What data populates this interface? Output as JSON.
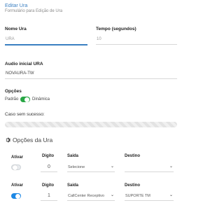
{
  "header": {
    "title": "Editar Ura",
    "subtitle": "Formulário para Edição de Ura"
  },
  "form": {
    "nome_ura": {
      "label": "Nome Ura",
      "value": "URA"
    },
    "tempo": {
      "label": "Tempo (segundos)",
      "value": "10"
    },
    "audio": {
      "label": "Audio inicial URA",
      "value": "NOVAURA-TW"
    },
    "opcoes": {
      "label": "Opções",
      "left": "Padrão",
      "right": "Dinâmica",
      "state": "on"
    },
    "caso_sem_sucesso": {
      "label": "Caso sem sucesso:"
    }
  },
  "opcoes_ura": {
    "title": "Opções da Ura",
    "icon": "gear-icon",
    "columns": {
      "ativar": "Ativar",
      "digito": "Digito",
      "saida": "Saida",
      "destino": "Destino"
    },
    "rows": [
      {
        "ativar": "off",
        "digito": "0",
        "saida": "Selecione",
        "destino": ""
      },
      {
        "ativar": "on",
        "digito": "1",
        "saida": "CallCenter Receptivo",
        "destino": "SUPORTE TM"
      }
    ]
  },
  "colors": {
    "accent": "#3a7fc1",
    "toggle_green": "#28a745",
    "toggle_blue": "#1e88e5"
  }
}
